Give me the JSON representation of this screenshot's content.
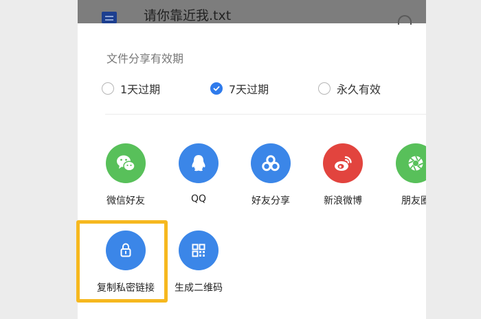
{
  "file": {
    "name": "请你靠近我.txt",
    "icon": "document-icon"
  },
  "validity": {
    "title": "文件分享有效期",
    "options": [
      {
        "label": "1天过期",
        "checked": false
      },
      {
        "label": "7天过期",
        "checked": true
      },
      {
        "label": "永久有效",
        "checked": false
      }
    ]
  },
  "share": {
    "row1": [
      {
        "label": "微信好友",
        "icon": "wechat-icon",
        "color": "#58c05a"
      },
      {
        "label": "QQ",
        "icon": "qq-icon",
        "color": "#3b86e8"
      },
      {
        "label": "好友分享",
        "icon": "friend-share-icon",
        "color": "#3b86e8"
      },
      {
        "label": "新浪微博",
        "icon": "weibo-icon",
        "color": "#e2443e"
      },
      {
        "label": "朋友圈",
        "icon": "moments-icon",
        "color": "#58c05a"
      }
    ],
    "row2": [
      {
        "label": "复制私密链接",
        "icon": "lock-icon",
        "color": "#3b86e8"
      },
      {
        "label": "生成二维码",
        "icon": "qr-code-icon",
        "color": "#3b86e8"
      }
    ]
  },
  "colors": {
    "accent": "#2f7bec",
    "highlight": "#f6b81f"
  }
}
